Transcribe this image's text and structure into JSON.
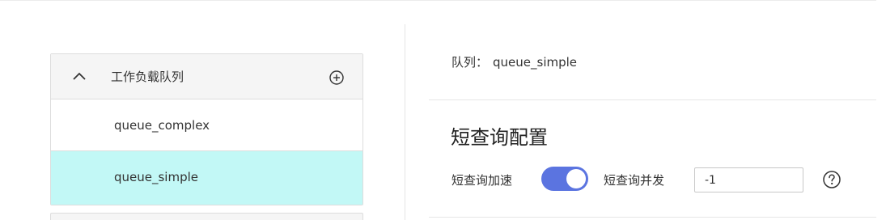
{
  "sidebar": {
    "title": "工作负载队列",
    "items": [
      {
        "label": "queue_complex",
        "selected": false
      },
      {
        "label": "queue_simple",
        "selected": true
      }
    ]
  },
  "detail": {
    "queue_label": "队列：",
    "queue_name": "queue_simple",
    "section_title": "短查询配置",
    "accel_label": "短查询加速",
    "accel_enabled": true,
    "concurrency_label": "短查询并发",
    "concurrency_value": "-1"
  },
  "icons": {
    "collapse": "chevron-up-icon",
    "add": "add-circle-icon",
    "help": "help-icon"
  },
  "colors": {
    "selected_row": "#c2f8f6",
    "toggle_on": "#5b74e0",
    "header_bg": "#f5f5f5"
  }
}
